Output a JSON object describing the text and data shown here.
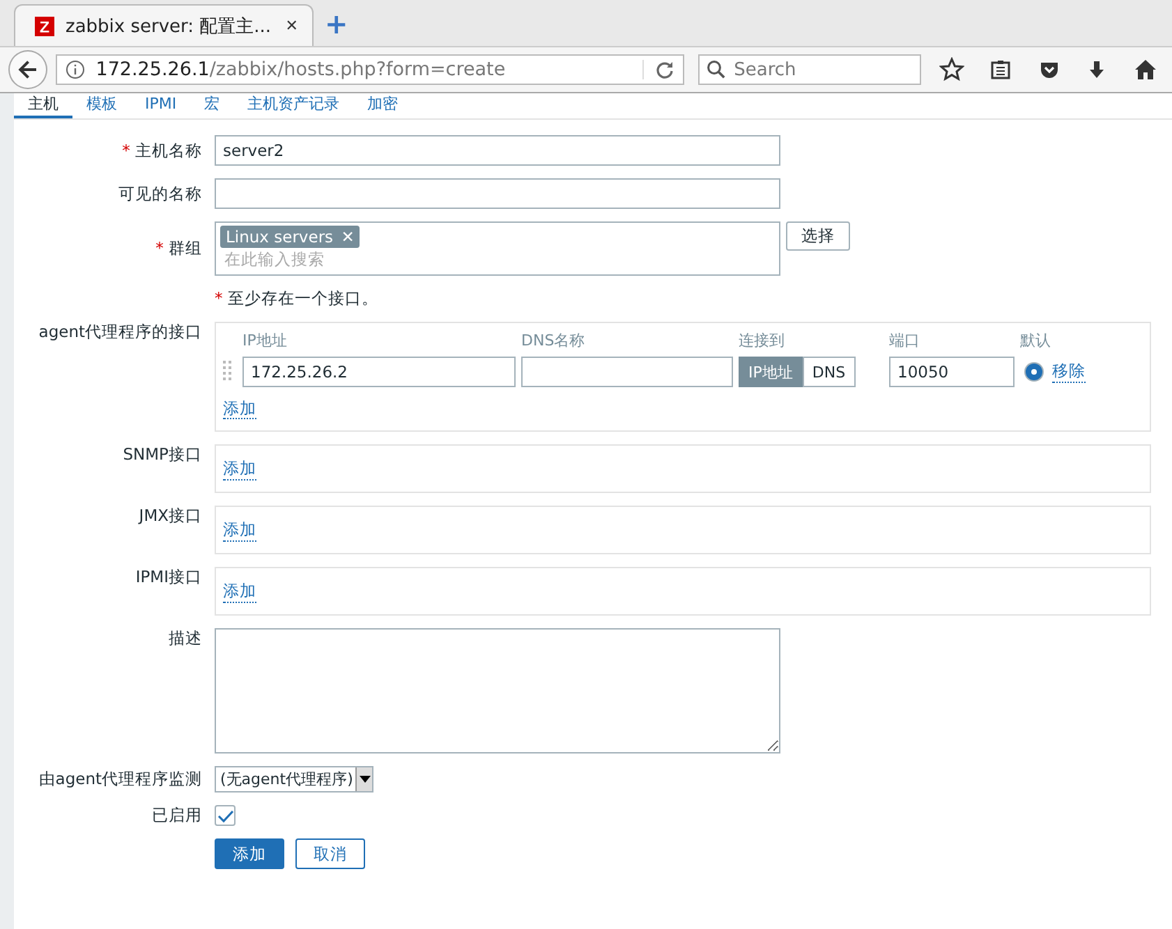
{
  "browser": {
    "tab_title": "zabbix server: 配置主...",
    "tab_close": "✕",
    "new_tab": "+",
    "url_host": "172.25.26.1",
    "url_path": "/zabbix/hosts.php?form=create",
    "search_placeholder": "Search"
  },
  "tabs": [
    {
      "label": "主机",
      "selected": true
    },
    {
      "label": "模板",
      "selected": false
    },
    {
      "label": "IPMI",
      "selected": false
    },
    {
      "label": "宏",
      "selected": false
    },
    {
      "label": "主机资产记录",
      "selected": false
    },
    {
      "label": "加密",
      "selected": false
    }
  ],
  "host_name": {
    "label": "主机名称",
    "required": true,
    "value": "server2"
  },
  "visible_name": {
    "label": "可见的名称"
  },
  "groups": {
    "label": "群组",
    "required": true,
    "tags": [
      {
        "label": "Linux servers",
        "remove": "✕"
      }
    ],
    "placeholder": "在此输入搜索",
    "select_button": "选择"
  },
  "note": {
    "marker": "*",
    "text": "至少存在一个接口。"
  },
  "agent": {
    "label": "agent代理程序的接口",
    "columns": [
      "IP地址",
      "DNS名称",
      "连接到",
      "端口",
      "默认"
    ],
    "rows": [
      {
        "ip": "172.25.26.2",
        "dns": "",
        "connect": [
          {
            "label": "IP地址",
            "selected": true
          },
          {
            "label": "DNS",
            "selected": false
          }
        ],
        "port": "10050",
        "default": true,
        "remove": "移除"
      }
    ],
    "add": "添加"
  },
  "other_interfaces": [
    {
      "label": "SNMP接口",
      "add": "添加"
    },
    {
      "label": "JMX接口",
      "add": "添加"
    },
    {
      "label": "IPMI接口",
      "add": "添加"
    }
  ],
  "description": {
    "label": "描述"
  },
  "proxy": {
    "label": "由agent代理程序监测",
    "value": "(无agent代理程序)"
  },
  "enabled": {
    "label": "已启用",
    "checked": true
  },
  "buttons": [
    {
      "label": "添加",
      "kind": "primary"
    },
    {
      "label": "取消",
      "kind": "secondary"
    }
  ]
}
